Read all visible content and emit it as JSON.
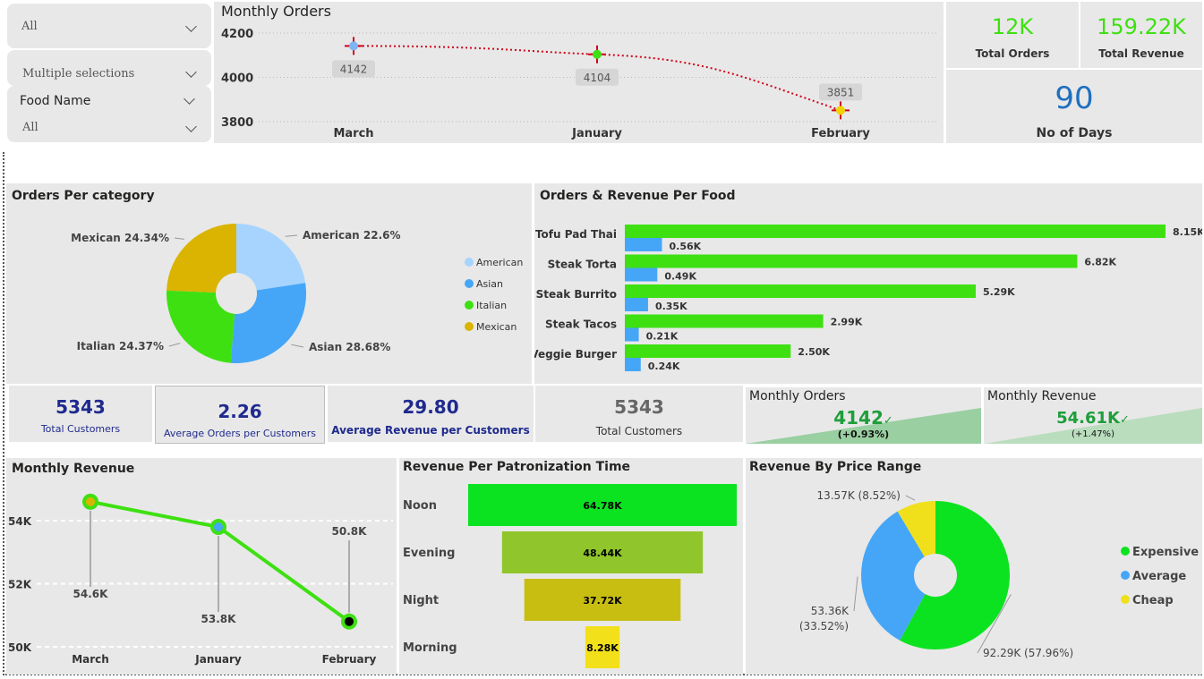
{
  "slicers": {
    "slicer1_value": "All",
    "slicer2_value": "Multiple selections",
    "food_name_label": "Food Name",
    "food_name_value": "All"
  },
  "cards": {
    "total_orders_value": "12K",
    "total_orders_label": "Total Orders",
    "total_revenue_value": "159.22K",
    "total_revenue_label": "Total Revenue",
    "no_of_days_value": "90",
    "no_of_days_label": "No of Days",
    "total_customers_value": "5343",
    "total_customers_label": "Total Customers",
    "avg_orders_value": "2.26",
    "avg_orders_label": "Average Orders per Customers",
    "avg_revenue_value": "29.80",
    "avg_revenue_label": "Average Revenue per Customers",
    "total_customers2_value": "5343",
    "total_customers2_label": "Total Customers"
  },
  "kpis": {
    "monthly_orders": {
      "title": "Monthly Orders",
      "value": "4142",
      "change": "(+0.93%)"
    },
    "monthly_revenue": {
      "title": "Monthly Revenue",
      "value": "54.61K",
      "change": "(+1.47%)"
    }
  },
  "colors": {
    "green": "#3ee012",
    "blue": "#45a6f7",
    "light_blue": "#a6d4ff",
    "gold": "#dab400",
    "dark_navy": "#1f2a8e",
    "days_blue": "#1f6fbf"
  },
  "chart_data": [
    {
      "id": "monthly_orders_line",
      "type": "line",
      "title": "Monthly Orders",
      "categories": [
        "March",
        "January",
        "February"
      ],
      "values": [
        4142,
        4104,
        3851
      ],
      "data_labels": [
        "4142",
        "4104",
        "3851"
      ],
      "y_ticks": [
        "4200",
        "4000",
        "3800"
      ],
      "ylim": [
        3780,
        4220
      ]
    },
    {
      "id": "orders_per_category_donut",
      "type": "pie",
      "title": "Orders Per category",
      "categories": [
        "American",
        "Asian",
        "Italian",
        "Mexican"
      ],
      "values": [
        22.6,
        28.68,
        24.37,
        24.34
      ],
      "slice_labels": [
        "American 22.6%",
        "Asian 28.68%",
        "Italian 24.37%",
        "Mexican 24.34%"
      ],
      "legend": [
        "American",
        "Asian",
        "Italian",
        "Mexican"
      ],
      "legend_position": "right"
    },
    {
      "id": "orders_revenue_per_food_bar",
      "type": "bar",
      "orientation": "horizontal",
      "title": "Orders & Revenue Per Food",
      "categories": [
        "Tofu Pad Thai",
        "Steak Torta",
        "Steak Burrito",
        "Steak Tacos",
        "Veggie Burger"
      ],
      "series": [
        {
          "values": [
            8150,
            6820,
            5290,
            2990,
            2500
          ],
          "labels": [
            "8.15K",
            "6.82K",
            "5.29K",
            "2.99K",
            "2.50K"
          ]
        },
        {
          "values": [
            560,
            490,
            350,
            210,
            240
          ],
          "labels": [
            "0.56K",
            "0.49K",
            "0.35K",
            "0.21K",
            "0.24K"
          ]
        }
      ],
      "xlim": [
        0,
        8150
      ]
    },
    {
      "id": "monthly_revenue_line",
      "type": "line",
      "title": "Monthly Revenue",
      "categories": [
        "March",
        "January",
        "February"
      ],
      "values": [
        54.6,
        53.8,
        50.8
      ],
      "data_labels": [
        "54.6K",
        "53.8K",
        "50.8K"
      ],
      "y_ticks": [
        "54K",
        "52K",
        "50K"
      ],
      "ylim": [
        50,
        55
      ]
    },
    {
      "id": "revenue_per_patronization_funnel",
      "type": "bar",
      "subtype": "funnel",
      "title": "Revenue Per Patronization Time",
      "categories": [
        "Noon",
        "Evening",
        "Night",
        "Morning"
      ],
      "values": [
        64.78,
        48.44,
        37.72,
        8.28
      ],
      "labels": [
        "64.78K",
        "48.44K",
        "37.72K",
        "8.28K"
      ]
    },
    {
      "id": "revenue_by_price_range_donut",
      "type": "pie",
      "title": "Revenue By Price Range",
      "categories": [
        "Expensive",
        "Average",
        "Cheap"
      ],
      "values": [
        92.29,
        53.36,
        13.57
      ],
      "percents": [
        57.96,
        33.52,
        8.52
      ],
      "slice_labels": [
        "92.29K (57.96%)",
        "53.36K (33.52%)",
        "13.57K (8.52%)"
      ],
      "legend": [
        "Expensive",
        "Average",
        "Cheap"
      ],
      "legend_position": "right"
    }
  ]
}
